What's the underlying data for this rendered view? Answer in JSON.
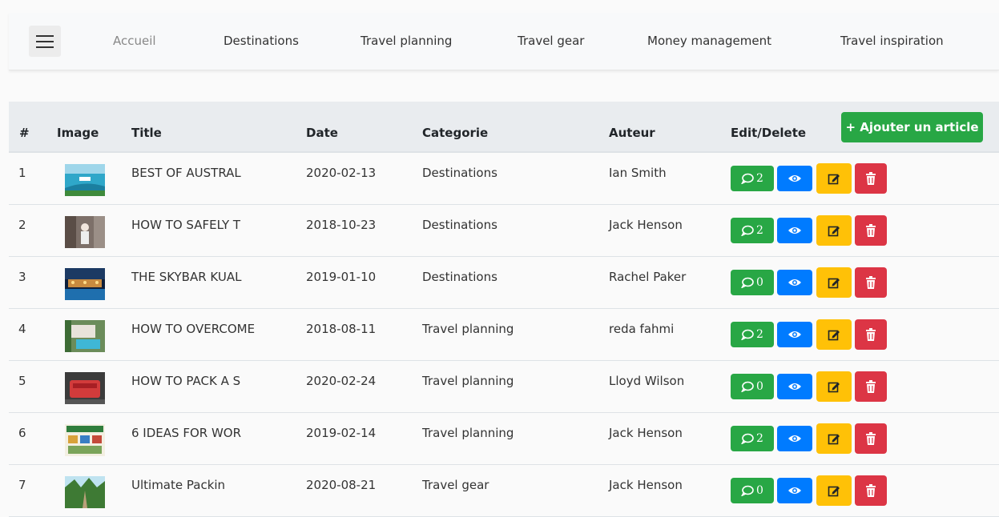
{
  "nav": {
    "items": [
      {
        "label": "Accueil",
        "active": true
      },
      {
        "label": "Destinations",
        "active": false
      },
      {
        "label": "Travel planning",
        "active": false
      },
      {
        "label": "Travel gear",
        "active": false
      },
      {
        "label": "Money management",
        "active": false
      },
      {
        "label": "Travel inspiration",
        "active": false
      }
    ]
  },
  "table": {
    "columns": [
      "#",
      "Image",
      "Title",
      "Date",
      "Categorie",
      "Auteur",
      "Edit/Delete"
    ],
    "add_button_label": "+ Ajouter un article",
    "rows": [
      {
        "num": "1",
        "title": "BEST OF AUSTRAL",
        "date": "2020-02-13",
        "category": "Destinations",
        "author": "Ian Smith",
        "comments": "2",
        "thumb": "ocean-boat"
      },
      {
        "num": "2",
        "title": "HOW TO SAFELY T",
        "date": "2018-10-23",
        "category": "Destinations",
        "author": "Jack Henson",
        "comments": "2",
        "thumb": "street-people"
      },
      {
        "num": "3",
        "title": "THE SKYBAR KUAL",
        "date": "2019-01-10",
        "category": "Destinations",
        "author": "Rachel Paker",
        "comments": "0",
        "thumb": "night-pool"
      },
      {
        "num": "4",
        "title": "HOW TO OVERCOME",
        "date": "2018-08-11",
        "category": "Travel planning",
        "author": "reda fahmi",
        "comments": "2",
        "thumb": "resort-pool"
      },
      {
        "num": "5",
        "title": "HOW TO PACK A S",
        "date": "2020-02-24",
        "category": "Travel planning",
        "author": "Lloyd Wilson",
        "comments": "0",
        "thumb": "suitcase"
      },
      {
        "num": "6",
        "title": "6 IDEAS FOR WOR",
        "date": "2019-02-14",
        "category": "Travel planning",
        "author": "Jack Henson",
        "comments": "2",
        "thumb": "poster"
      },
      {
        "num": "7",
        "title": "Ultimate Packin",
        "date": "2020-08-21",
        "category": "Travel gear",
        "author": "Jack Henson",
        "comments": "0",
        "thumb": "forest-road"
      }
    ]
  },
  "colors": {
    "success": "#28a745",
    "primary": "#007bff",
    "warning": "#ffc107",
    "danger": "#dc3545"
  },
  "icons": {
    "menu": "hamburger-icon",
    "comments": "comment-icon",
    "view": "eye-icon",
    "edit": "edit-icon",
    "delete": "trash-icon"
  }
}
